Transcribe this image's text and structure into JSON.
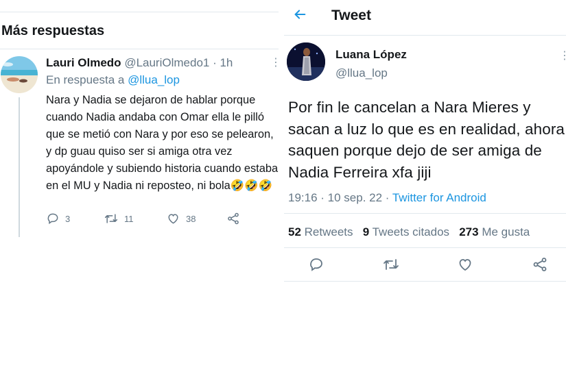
{
  "left": {
    "section_title": "Más respuestas",
    "reply": {
      "name": "Lauri Olmedo",
      "handle": "@LauriOlmedo1",
      "time": "· 1h",
      "reply_prefix": "En respuesta a",
      "reply_target": "@llua_lop",
      "text": "Nara y Nadia se dejaron de hablar porque cuando Nadia andaba con Omar ella le pilló que se metió con Nara y por eso se pelearon, y dp guau quiso ser si amiga otra vez apoyándole y subiendo historia cuando estaba en el MU y Nadia ni reposteo, ni bola🤣🤣🤣",
      "reply_count": "3",
      "retweet_count": "11",
      "like_count": "38",
      "more_icon": "⋮"
    }
  },
  "right": {
    "header_title": "Tweet",
    "tweet": {
      "name": "Luana López",
      "handle": "@llua_lop",
      "text": "Por fin le cancelan a Nara Mieres y sacan a luz lo que es en realidad, ahora saquen porque dejo de ser amiga de Nadia Ferreira xfa jiji",
      "time": "19:16 · 10 sep. 22 · ",
      "source": "Twitter for Android",
      "retweets_count": "52",
      "retweets_label": "Retweets",
      "quotes_count": "9",
      "quotes_label": "Tweets citados",
      "likes_count": "273",
      "likes_label": "Me gusta",
      "more_icon": "⋮"
    }
  },
  "icons": {
    "back": "arrow-left-icon",
    "reply": "comment-icon",
    "retweet": "retweet-icon",
    "like": "heart-icon",
    "share": "share-icon"
  },
  "colors": {
    "accent": "#1b95e0",
    "secondary_text": "#657786",
    "primary_text": "#14171a",
    "separator": "#e1e8ed"
  }
}
